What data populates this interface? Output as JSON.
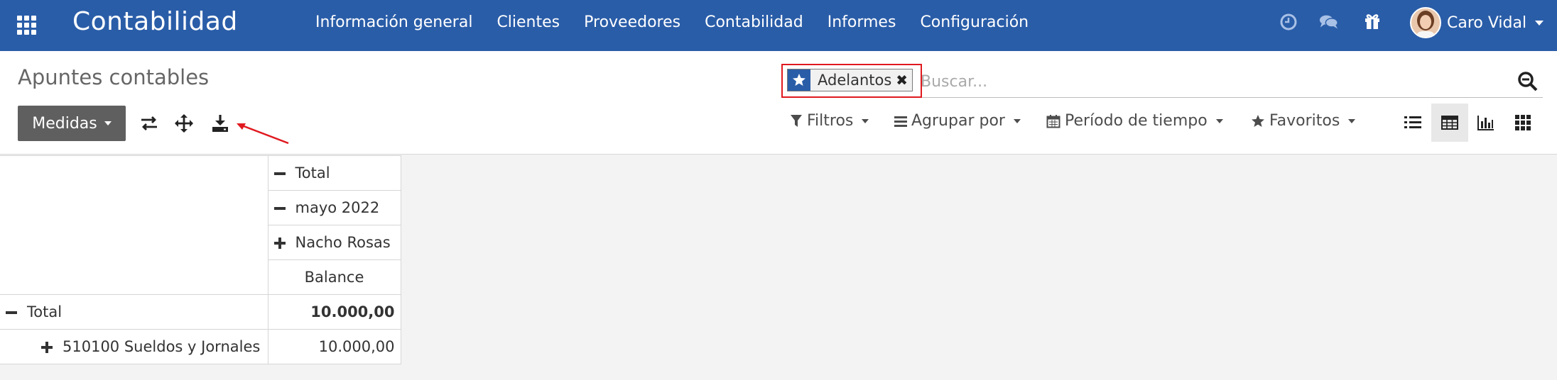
{
  "app": {
    "title": "Contabilidad"
  },
  "menu": {
    "items": [
      "Información general",
      "Clientes",
      "Proveedores",
      "Contabilidad",
      "Informes",
      "Configuración"
    ]
  },
  "systray": {
    "icons": [
      "activity-clock-icon",
      "messages-icon",
      "gift-icon"
    ]
  },
  "user": {
    "name": "Caro Vidal"
  },
  "page": {
    "title": "Apuntes contables"
  },
  "toolbar": {
    "measures_label": "Medidas",
    "icons": [
      "flip-axis-icon",
      "expand-all-icon",
      "download-icon"
    ]
  },
  "search": {
    "facet_label": "Adelantos",
    "placeholder": "Buscar..."
  },
  "filters": {
    "filters_label": "Filtros",
    "group_by_label": "Agrupar por",
    "period_label": "Período de tiempo",
    "favorites_label": "Favoritos"
  },
  "views": {
    "list": "list-view-icon",
    "pivot": "pivot-view-icon",
    "graph": "graph-view-icon",
    "kanban": "kanban-view-icon",
    "active": "pivot"
  },
  "pivot": {
    "col_headers": [
      "Total",
      "mayo 2022",
      "Nacho Rosas"
    ],
    "measure": "Balance",
    "rows": [
      {
        "label": "Total",
        "value": "10.000,00"
      },
      {
        "label": "510100 Sueldos y Jornales",
        "value": "10.000,00"
      }
    ]
  },
  "colors": {
    "navbar": "#2a5da8",
    "highlight": "#e0191f",
    "arrow": "#e0191f"
  }
}
